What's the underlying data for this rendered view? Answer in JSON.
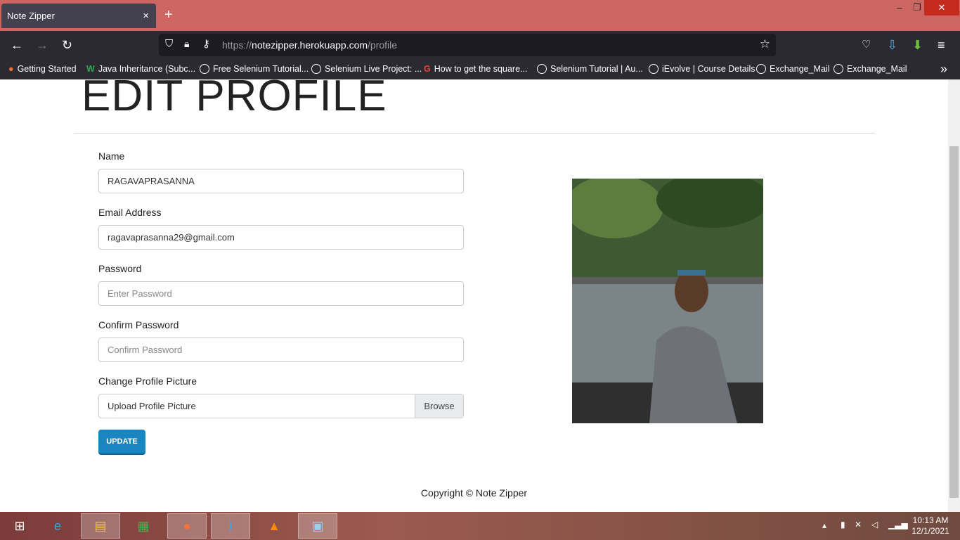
{
  "browser": {
    "tab_title": "Note Zipper",
    "tab_close": "×",
    "new_tab": "+",
    "url_prefix": "https://",
    "url_host": "notezipper.herokuapp.com",
    "url_path": "/profile",
    "window_controls": {
      "minimize": "–",
      "restore": "❐",
      "close": "✕"
    },
    "bookmarks": [
      "Getting Started",
      "Java Inheritance (Subc...",
      "Free Selenium Tutorial...",
      "Selenium Live Project: ...",
      "How to get the square...",
      "Selenium Tutorial | Au...",
      "iEvolve | Course Details",
      "Exchange_Mail",
      "Exchange_Mail"
    ],
    "bookmarks_overflow": "»"
  },
  "page": {
    "title": "EDIT PROFILE",
    "form": {
      "name_label": "Name",
      "name_value": "RAGAVAPRASANNA",
      "email_label": "Email Address",
      "email_value": "ragavaprasanna29@gmail.com",
      "password_label": "Password",
      "password_placeholder": "Enter Password",
      "confirm_label": "Confirm Password",
      "confirm_placeholder": "Confirm Password",
      "picture_label": "Change Profile Picture",
      "picture_placeholder": "Upload Profile Picture",
      "browse_label": "Browse",
      "update_label": "UPDATE"
    },
    "footer": "Copyright © Note Zipper"
  },
  "taskbar": {
    "time": "10:13 AM",
    "date": "12/1/2021"
  },
  "colors": {
    "titlebar": "#cd6662",
    "toolbar": "#2b2a33",
    "update_button": "#1a86c1"
  }
}
